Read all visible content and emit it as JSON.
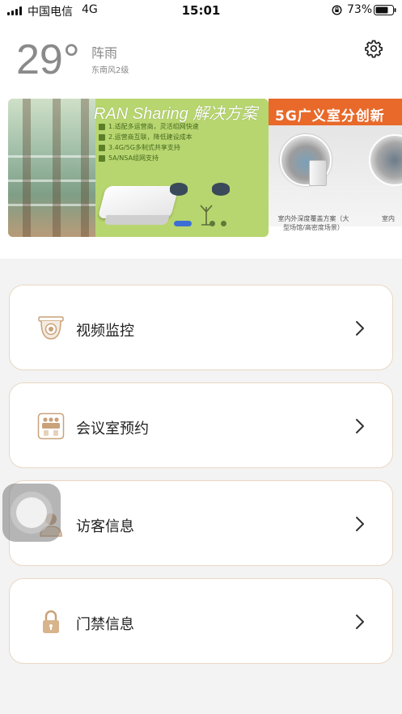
{
  "status_bar": {
    "carrier": "中国电信",
    "network": "4G",
    "time": "15:01",
    "battery_percent": "73%"
  },
  "weather": {
    "temperature": "29°",
    "condition": "阵雨",
    "wind": "东南风2级"
  },
  "banner": {
    "slide1": {
      "title": "RAN Sharing 解决方案",
      "points": [
        "1.适配多运营商，灵活组网快速",
        "2.运营商互联，降低建设成本",
        "3.4G/5G多制式共享支持",
        "5A/NSA组网支持"
      ]
    },
    "slide2": {
      "title": "5G广义室分创新",
      "caption": "室内外深度覆盖方案（大型场馆/高密度场景）",
      "caption2": "室内"
    },
    "active_index": 0,
    "total_slides": 3
  },
  "menu": [
    {
      "label": "视频监控",
      "icon": "camera-icon"
    },
    {
      "label": "会议室预约",
      "icon": "meeting-room-icon"
    },
    {
      "label": "访客信息",
      "icon": "visitor-icon"
    },
    {
      "label": "门禁信息",
      "icon": "lock-icon"
    }
  ],
  "colors": {
    "card_border": "#e9d7c2",
    "icon_gold": "#c9a27a",
    "background": "#f3f3f3"
  }
}
